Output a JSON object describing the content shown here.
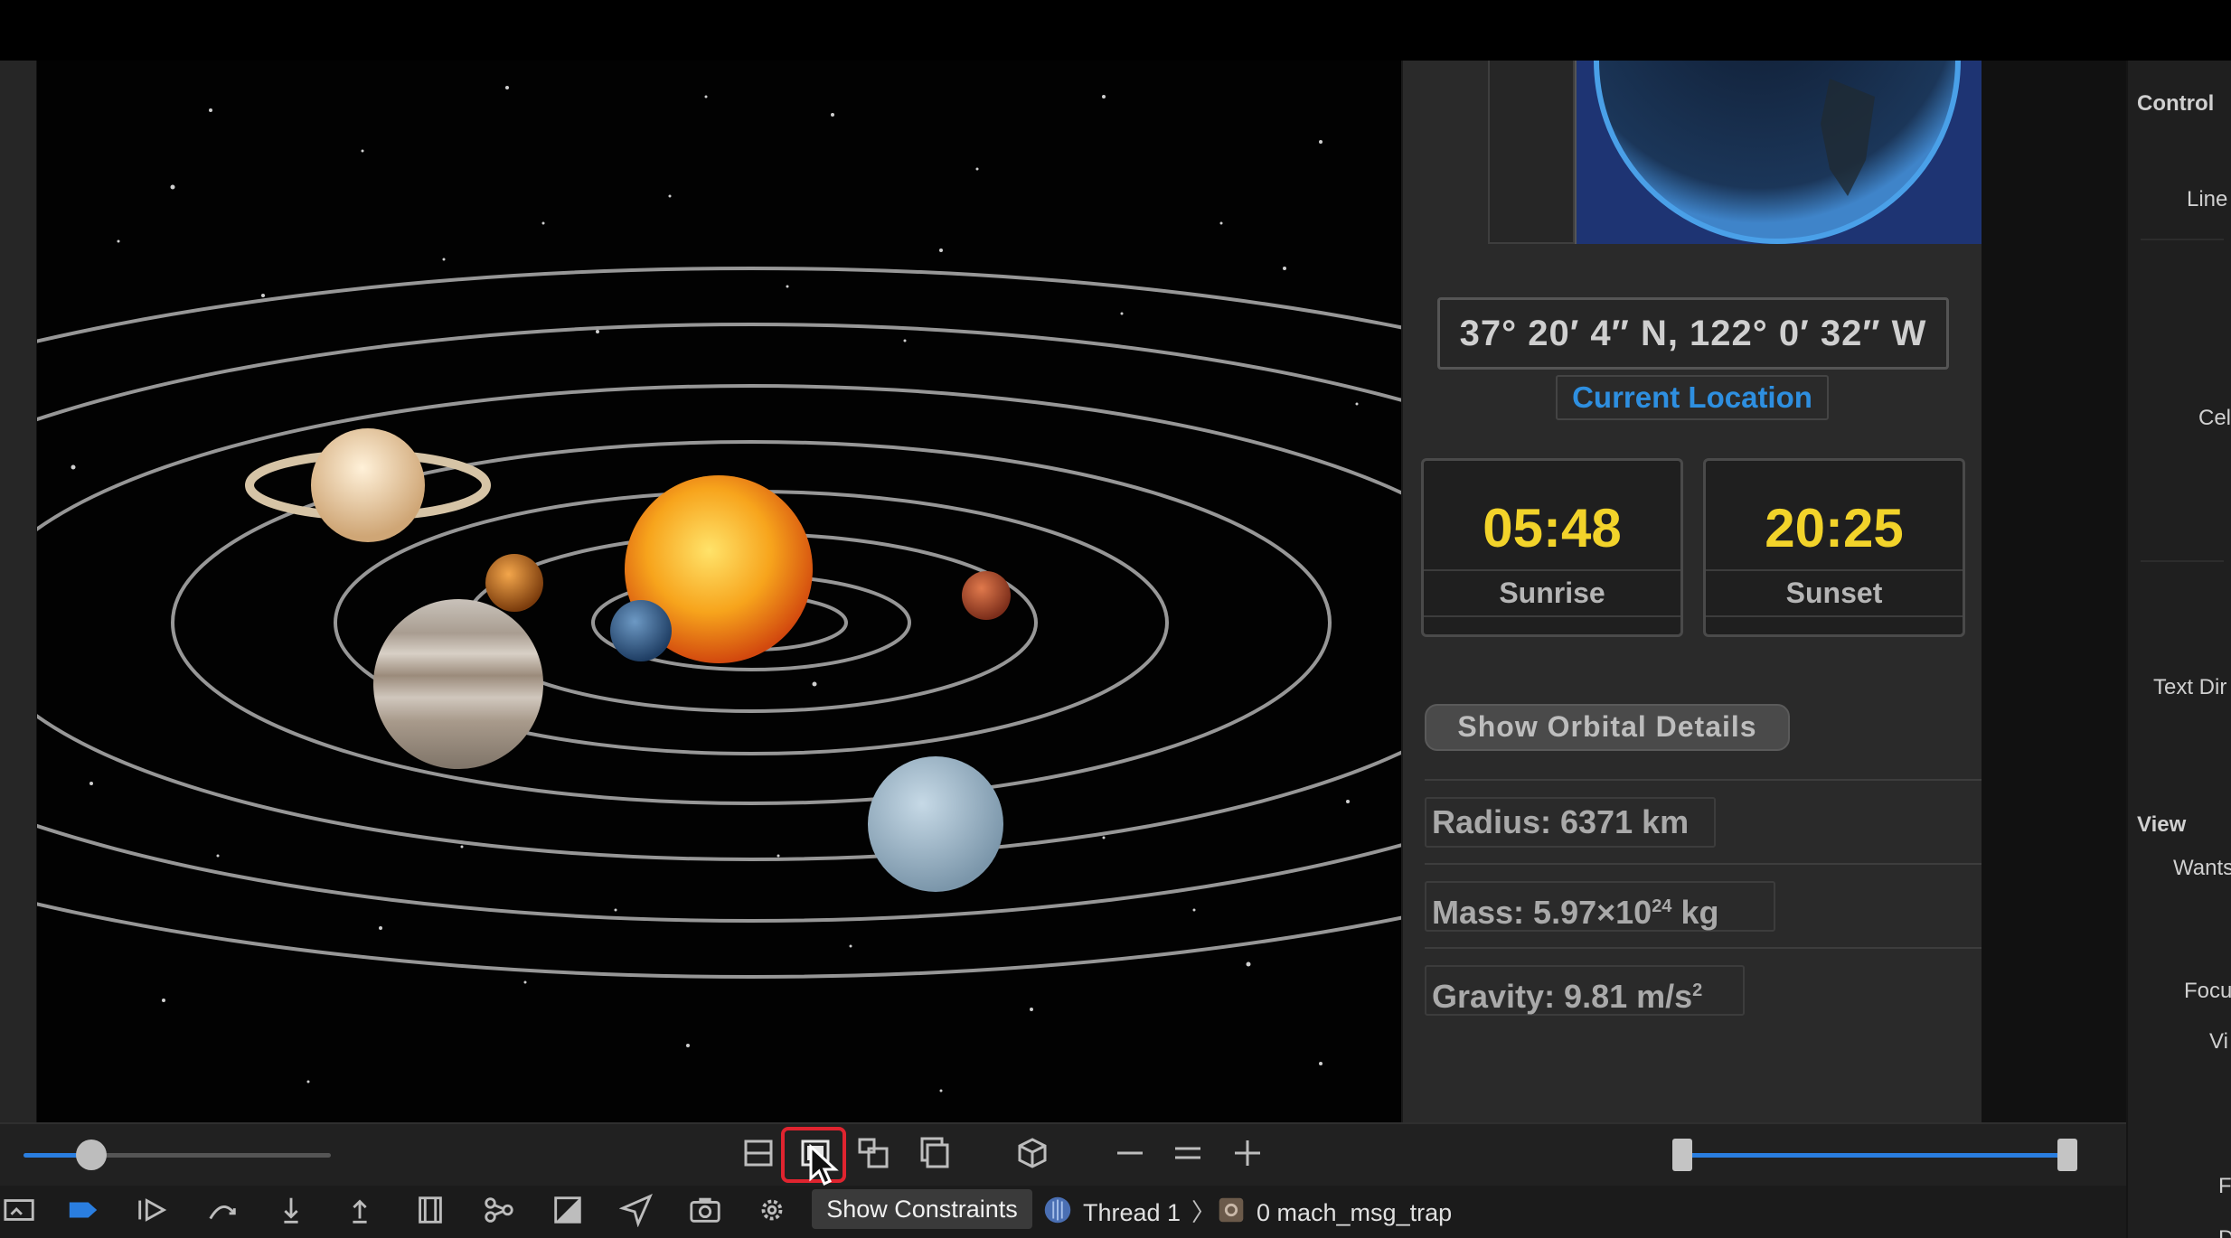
{
  "location": {
    "coordinates": "37° 20′ 4″ N, 122° 0′ 32″ W",
    "current_location_label": "Current Location"
  },
  "sun_times": {
    "sunrise_time": "05:48",
    "sunrise_label": "Sunrise",
    "sunset_time": "20:25",
    "sunset_label": "Sunset"
  },
  "orbital": {
    "button_label": "Show Orbital Details",
    "radius": "Radius: 6371 km",
    "mass_prefix": "Mass: 5.97×10",
    "mass_exp": "24",
    "mass_suffix": " kg",
    "gravity_prefix": "Gravity: 9.81 m/s",
    "gravity_exp": "2"
  },
  "inspector": {
    "control_heading": "Control",
    "line_label": "Line",
    "cell_label": "Cel",
    "text_direction_label": "Text Dir",
    "view_heading": "View",
    "wants_label": "Wants",
    "focus_label": "Focu",
    "vi_label": "Vi",
    "f_label": "F",
    "d_label": "D"
  },
  "debug": {
    "zoom_slider": 0.22,
    "range_slider_low": 0.0,
    "range_slider_high": 1.0,
    "accent_color": "#2a7ee0",
    "highlight_color": "#e0242f"
  },
  "statusbar": {
    "show_constraints_label": "Show Constraints",
    "thread_label": "Thread 1",
    "frame_label": "0 mach_msg_trap"
  },
  "icons": [
    "split-view-icon",
    "view-frames-icon",
    "view-hierarchy-icon",
    "copy-views-icon",
    "3d-box-icon",
    "zoom-out-icon",
    "zoom-reset-icon",
    "zoom-in-icon",
    "breakpoint-icon",
    "continue-icon",
    "step-over-icon",
    "step-into-icon",
    "step-out-icon",
    "debug-view-hierarchy-icon",
    "memory-graph-icon",
    "environment-overrides-icon",
    "location-icon",
    "camera-icon",
    "gear-icon"
  ]
}
